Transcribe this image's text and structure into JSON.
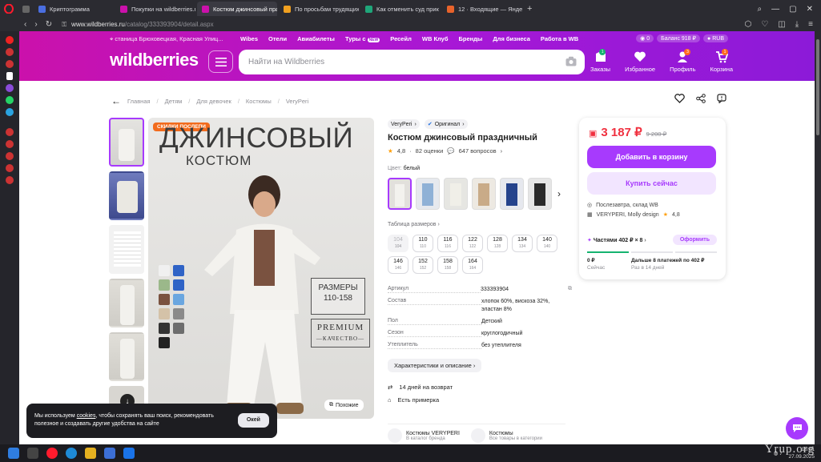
{
  "browser": {
    "tabs": [
      {
        "title": "Криптограмма",
        "color": "#4a6ee0"
      },
      {
        "title": "Покупки на wildberries.ru",
        "color": "#cb11ab"
      },
      {
        "title": "Костюм джинсовый пра",
        "color": "#cb11ab",
        "active": true
      },
      {
        "title": "По просьбам трудящих",
        "color": "#f0a020"
      },
      {
        "title": "Как отменить суд прик",
        "color": "#1fa67a"
      },
      {
        "title": "12 · Входящие — Яндек",
        "color": "#e8632b"
      }
    ],
    "url_host": "www.wildberries.ru",
    "url_path": "/catalog/333393904/detail.aspx"
  },
  "header": {
    "geo": "станица Брюховецкая, Красная Улиц...",
    "nav": [
      "Wibes",
      "Отели",
      "Авиабилеты",
      "Туры с",
      "Ресейл",
      "WB Клуб",
      "Бренды",
      "Для бизнеса",
      "Работа в WB"
    ],
    "tours_badge": "NEW",
    "pills": [
      "0",
      "Баланс 918 ₽",
      "RUB"
    ],
    "logo": "wildberries",
    "search_placeholder": "Найти на Wildberries",
    "actions": [
      {
        "label": "Заказы",
        "badge": "1",
        "icon": "box-icon"
      },
      {
        "label": "Избранное",
        "badge": "",
        "icon": "heart-icon"
      },
      {
        "label": "Профиль",
        "badge": "3",
        "icon": "user-icon"
      },
      {
        "label": "Корзина",
        "badge": "1",
        "icon": "cart-icon"
      }
    ]
  },
  "breadcrumbs": [
    "Главная",
    "Детям",
    "Для девочек",
    "Костюмы",
    "VeryPeri"
  ],
  "gallery": {
    "badge": "СКИДКИ ПОСЛЕПИ",
    "title_big": "ДЖИНСОВЫЙ",
    "title_small": "КОСТЮМ",
    "sizes_label": "РАЗМЕРЫ",
    "sizes_range": "110-158",
    "premium": "PREMIUM",
    "quality": "—КАЧЕСТВО—",
    "similar": "Похожие",
    "swatch_colors": [
      "#f0f0f0",
      "#f0f0f0",
      "#2f63c6",
      "#9bb88a",
      "#2f63c6",
      "#7a5240",
      "#6aa6e0",
      "#d4c2a8",
      "#8a8a8a",
      "#333333",
      "#6d6d6d",
      "#222222"
    ]
  },
  "product": {
    "brand": "VeryPeri",
    "original": "Оригинал",
    "title": "Костюм джинсовый праздничный",
    "rating": "4,8",
    "reviews": "82 оценки",
    "questions": "647 вопросов",
    "color_label": "Цвет:",
    "color_value": "белый",
    "size_table": "Таблица размеров",
    "sizes": [
      {
        "s": "104",
        "r": "104",
        "disabled": true
      },
      {
        "s": "110",
        "r": "110"
      },
      {
        "s": "116",
        "r": "116"
      },
      {
        "s": "122",
        "r": "122"
      },
      {
        "s": "128",
        "r": "128"
      },
      {
        "s": "134",
        "r": "134"
      },
      {
        "s": "140",
        "r": "140"
      },
      {
        "s": "146",
        "r": "146"
      },
      {
        "s": "152",
        "r": "152"
      },
      {
        "s": "158",
        "r": "158"
      },
      {
        "s": "164",
        "r": "164"
      }
    ],
    "specs": [
      {
        "k": "Артикул",
        "v": "333393904"
      },
      {
        "k": "Состав",
        "v": "хлопок 60%, вискоза 32%, эластан 8%"
      },
      {
        "k": "Пол",
        "v": "Детский"
      },
      {
        "k": "Сезон",
        "v": "круглогодичный"
      },
      {
        "k": "Утеплитель",
        "v": "без утеплителя"
      }
    ],
    "details_button": "Характеристики и описание",
    "returns": "14 дней на возврат",
    "fitting": "Есть примерка",
    "bottom_cards": [
      {
        "t": "Костюмы VERYPERI",
        "s": "В каталог бренда"
      },
      {
        "t": "Костюмы",
        "s": "Все товары в категории"
      }
    ]
  },
  "buy": {
    "price": "3 187 ₽",
    "old_price": "9 200 ₽",
    "add_to_cart": "Добавить в корзину",
    "buy_now": "Купить сейчас",
    "delivery": "Послезавтра, склад WB",
    "seller": "VERYPERI, Molly design",
    "seller_rating": "4,8",
    "split_label": "Частями 402 ₽ × 8",
    "split_button": "Оформить",
    "plan_now_amount": "0 ₽",
    "plan_now_label": "Сейчас",
    "plan_later_amount": "Дальше 8 платежей по 402 ₽",
    "plan_later_label": "Раз в 14 дней"
  },
  "cookie": {
    "text_a": "Мы используем",
    "link": "cookies",
    "text_b": ", чтобы сохранять ваш поиск, рекомендовать полезное и создавать другие удобства на сайте",
    "ok": "Окей"
  },
  "taskbar": {
    "time": "16:41",
    "date": "27.09.2025"
  },
  "watermark": "Yrup.org",
  "colors": {
    "brand_pink": "#cb11ab",
    "brand_purple": "#a73afd",
    "price_red": "#f0303f"
  }
}
